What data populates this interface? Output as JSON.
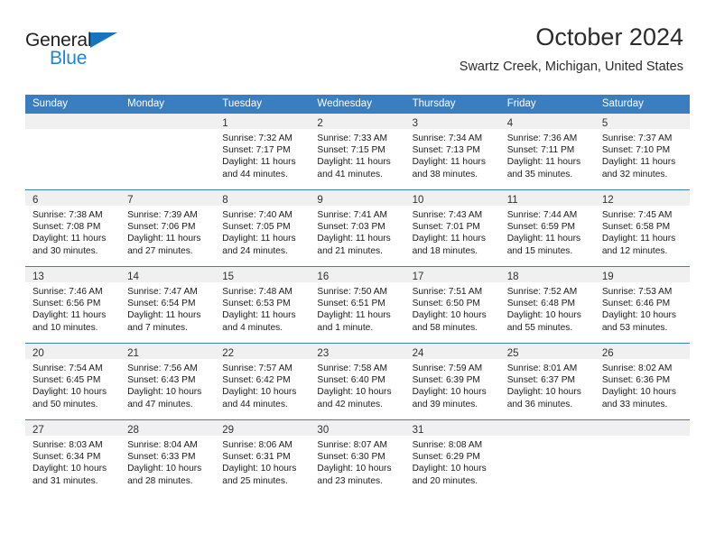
{
  "brand": {
    "word1": "General",
    "word2": "Blue",
    "triangle_color": "#1574bb",
    "word2_color": "#1f86d0"
  },
  "header": {
    "title": "October 2024",
    "subtitle": "Swartz Creek, Michigan, United States",
    "header_bg": "#3a7ebf"
  },
  "weekday_headers": [
    "Sunday",
    "Monday",
    "Tuesday",
    "Wednesday",
    "Thursday",
    "Friday",
    "Saturday"
  ],
  "labels": {
    "sunrise": "Sunrise:",
    "sunset": "Sunset:",
    "daylight": "Daylight:"
  },
  "weeks": [
    [
      {
        "blank": true
      },
      {
        "blank": true
      },
      {
        "day": "1",
        "sunrise": "Sunrise: 7:32 AM",
        "sunset": "Sunset: 7:17 PM",
        "daylight_l1": "Daylight: 11 hours",
        "daylight_l2": "and 44 minutes."
      },
      {
        "day": "2",
        "sunrise": "Sunrise: 7:33 AM",
        "sunset": "Sunset: 7:15 PM",
        "daylight_l1": "Daylight: 11 hours",
        "daylight_l2": "and 41 minutes."
      },
      {
        "day": "3",
        "sunrise": "Sunrise: 7:34 AM",
        "sunset": "Sunset: 7:13 PM",
        "daylight_l1": "Daylight: 11 hours",
        "daylight_l2": "and 38 minutes."
      },
      {
        "day": "4",
        "sunrise": "Sunrise: 7:36 AM",
        "sunset": "Sunset: 7:11 PM",
        "daylight_l1": "Daylight: 11 hours",
        "daylight_l2": "and 35 minutes."
      },
      {
        "day": "5",
        "sunrise": "Sunrise: 7:37 AM",
        "sunset": "Sunset: 7:10 PM",
        "daylight_l1": "Daylight: 11 hours",
        "daylight_l2": "and 32 minutes."
      }
    ],
    [
      {
        "day": "6",
        "sunrise": "Sunrise: 7:38 AM",
        "sunset": "Sunset: 7:08 PM",
        "daylight_l1": "Daylight: 11 hours",
        "daylight_l2": "and 30 minutes."
      },
      {
        "day": "7",
        "sunrise": "Sunrise: 7:39 AM",
        "sunset": "Sunset: 7:06 PM",
        "daylight_l1": "Daylight: 11 hours",
        "daylight_l2": "and 27 minutes."
      },
      {
        "day": "8",
        "sunrise": "Sunrise: 7:40 AM",
        "sunset": "Sunset: 7:05 PM",
        "daylight_l1": "Daylight: 11 hours",
        "daylight_l2": "and 24 minutes."
      },
      {
        "day": "9",
        "sunrise": "Sunrise: 7:41 AM",
        "sunset": "Sunset: 7:03 PM",
        "daylight_l1": "Daylight: 11 hours",
        "daylight_l2": "and 21 minutes."
      },
      {
        "day": "10",
        "sunrise": "Sunrise: 7:43 AM",
        "sunset": "Sunset: 7:01 PM",
        "daylight_l1": "Daylight: 11 hours",
        "daylight_l2": "and 18 minutes."
      },
      {
        "day": "11",
        "sunrise": "Sunrise: 7:44 AM",
        "sunset": "Sunset: 6:59 PM",
        "daylight_l1": "Daylight: 11 hours",
        "daylight_l2": "and 15 minutes."
      },
      {
        "day": "12",
        "sunrise": "Sunrise: 7:45 AM",
        "sunset": "Sunset: 6:58 PM",
        "daylight_l1": "Daylight: 11 hours",
        "daylight_l2": "and 12 minutes."
      }
    ],
    [
      {
        "day": "13",
        "sunrise": "Sunrise: 7:46 AM",
        "sunset": "Sunset: 6:56 PM",
        "daylight_l1": "Daylight: 11 hours",
        "daylight_l2": "and 10 minutes."
      },
      {
        "day": "14",
        "sunrise": "Sunrise: 7:47 AM",
        "sunset": "Sunset: 6:54 PM",
        "daylight_l1": "Daylight: 11 hours",
        "daylight_l2": "and 7 minutes."
      },
      {
        "day": "15",
        "sunrise": "Sunrise: 7:48 AM",
        "sunset": "Sunset: 6:53 PM",
        "daylight_l1": "Daylight: 11 hours",
        "daylight_l2": "and 4 minutes."
      },
      {
        "day": "16",
        "sunrise": "Sunrise: 7:50 AM",
        "sunset": "Sunset: 6:51 PM",
        "daylight_l1": "Daylight: 11 hours",
        "daylight_l2": "and 1 minute."
      },
      {
        "day": "17",
        "sunrise": "Sunrise: 7:51 AM",
        "sunset": "Sunset: 6:50 PM",
        "daylight_l1": "Daylight: 10 hours",
        "daylight_l2": "and 58 minutes."
      },
      {
        "day": "18",
        "sunrise": "Sunrise: 7:52 AM",
        "sunset": "Sunset: 6:48 PM",
        "daylight_l1": "Daylight: 10 hours",
        "daylight_l2": "and 55 minutes."
      },
      {
        "day": "19",
        "sunrise": "Sunrise: 7:53 AM",
        "sunset": "Sunset: 6:46 PM",
        "daylight_l1": "Daylight: 10 hours",
        "daylight_l2": "and 53 minutes."
      }
    ],
    [
      {
        "day": "20",
        "sunrise": "Sunrise: 7:54 AM",
        "sunset": "Sunset: 6:45 PM",
        "daylight_l1": "Daylight: 10 hours",
        "daylight_l2": "and 50 minutes."
      },
      {
        "day": "21",
        "sunrise": "Sunrise: 7:56 AM",
        "sunset": "Sunset: 6:43 PM",
        "daylight_l1": "Daylight: 10 hours",
        "daylight_l2": "and 47 minutes."
      },
      {
        "day": "22",
        "sunrise": "Sunrise: 7:57 AM",
        "sunset": "Sunset: 6:42 PM",
        "daylight_l1": "Daylight: 10 hours",
        "daylight_l2": "and 44 minutes."
      },
      {
        "day": "23",
        "sunrise": "Sunrise: 7:58 AM",
        "sunset": "Sunset: 6:40 PM",
        "daylight_l1": "Daylight: 10 hours",
        "daylight_l2": "and 42 minutes."
      },
      {
        "day": "24",
        "sunrise": "Sunrise: 7:59 AM",
        "sunset": "Sunset: 6:39 PM",
        "daylight_l1": "Daylight: 10 hours",
        "daylight_l2": "and 39 minutes."
      },
      {
        "day": "25",
        "sunrise": "Sunrise: 8:01 AM",
        "sunset": "Sunset: 6:37 PM",
        "daylight_l1": "Daylight: 10 hours",
        "daylight_l2": "and 36 minutes."
      },
      {
        "day": "26",
        "sunrise": "Sunrise: 8:02 AM",
        "sunset": "Sunset: 6:36 PM",
        "daylight_l1": "Daylight: 10 hours",
        "daylight_l2": "and 33 minutes."
      }
    ],
    [
      {
        "day": "27",
        "sunrise": "Sunrise: 8:03 AM",
        "sunset": "Sunset: 6:34 PM",
        "daylight_l1": "Daylight: 10 hours",
        "daylight_l2": "and 31 minutes."
      },
      {
        "day": "28",
        "sunrise": "Sunrise: 8:04 AM",
        "sunset": "Sunset: 6:33 PM",
        "daylight_l1": "Daylight: 10 hours",
        "daylight_l2": "and 28 minutes."
      },
      {
        "day": "29",
        "sunrise": "Sunrise: 8:06 AM",
        "sunset": "Sunset: 6:31 PM",
        "daylight_l1": "Daylight: 10 hours",
        "daylight_l2": "and 25 minutes."
      },
      {
        "day": "30",
        "sunrise": "Sunrise: 8:07 AM",
        "sunset": "Sunset: 6:30 PM",
        "daylight_l1": "Daylight: 10 hours",
        "daylight_l2": "and 23 minutes."
      },
      {
        "day": "31",
        "sunrise": "Sunrise: 8:08 AM",
        "sunset": "Sunset: 6:29 PM",
        "daylight_l1": "Daylight: 10 hours",
        "daylight_l2": "and 20 minutes."
      },
      {
        "blank": true
      },
      {
        "blank": true
      }
    ]
  ]
}
